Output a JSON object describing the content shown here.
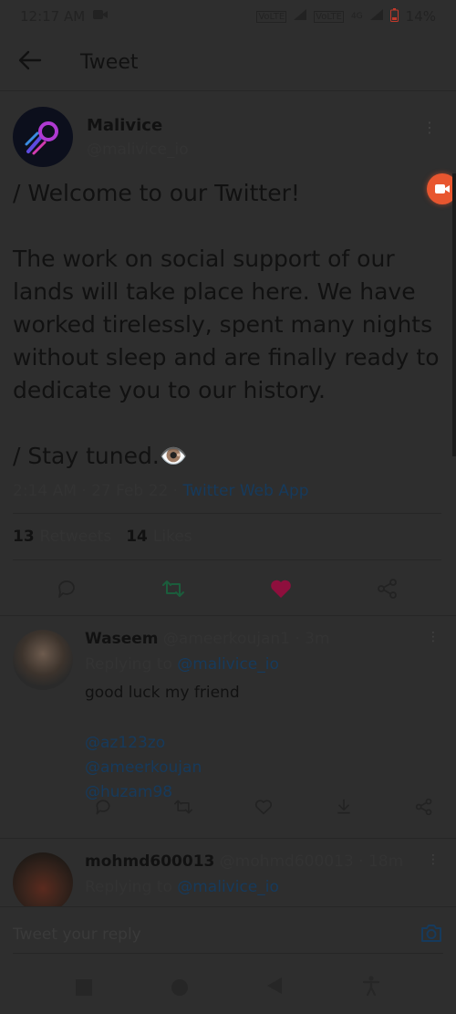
{
  "status_bar": {
    "time": "12:17 AM",
    "signal1": "VoLTE",
    "signal2": "VoLTE",
    "network": "4G",
    "battery": "14%"
  },
  "topbar": {
    "title": "Tweet"
  },
  "tweet": {
    "author_name": "Malivice",
    "author_handle": "@malivice_io",
    "text": "/ Welcome to our Twitter!\n\nThe work on social support of our lands will take place here. We have worked tirelessly, spent many nights without sleep and are finally ready to dedicate you to our history.\n\n/ Stay tuned.👁️",
    "time": "2:14 AM · 27 Feb 22 · ",
    "source": "Twitter Web App",
    "retweets": "13",
    "retweets_label": "Retweets",
    "likes": "14",
    "likes_label": "Likes"
  },
  "replies": [
    {
      "name": "Waseem",
      "handle": "@ameerkoujan1",
      "age": " · 3m",
      "replying_prefix": "Replying to ",
      "replying_to": "@malivice_io",
      "text": "good luck my friend",
      "mentions": [
        "@az123zo",
        "@ameerkoujan",
        "@huzam98"
      ]
    },
    {
      "name": "mohmd600013",
      "handle": "@mohmd600013",
      "age": " · 18m",
      "replying_prefix": "Replying to ",
      "replying_to": "@malivice_io"
    }
  ],
  "composer": {
    "placeholder": "Tweet your reply"
  },
  "colors": {
    "like": "#8e0f3d",
    "retweet": "#1b5d3c",
    "link": "#163a5c",
    "record": "#e8562f"
  }
}
